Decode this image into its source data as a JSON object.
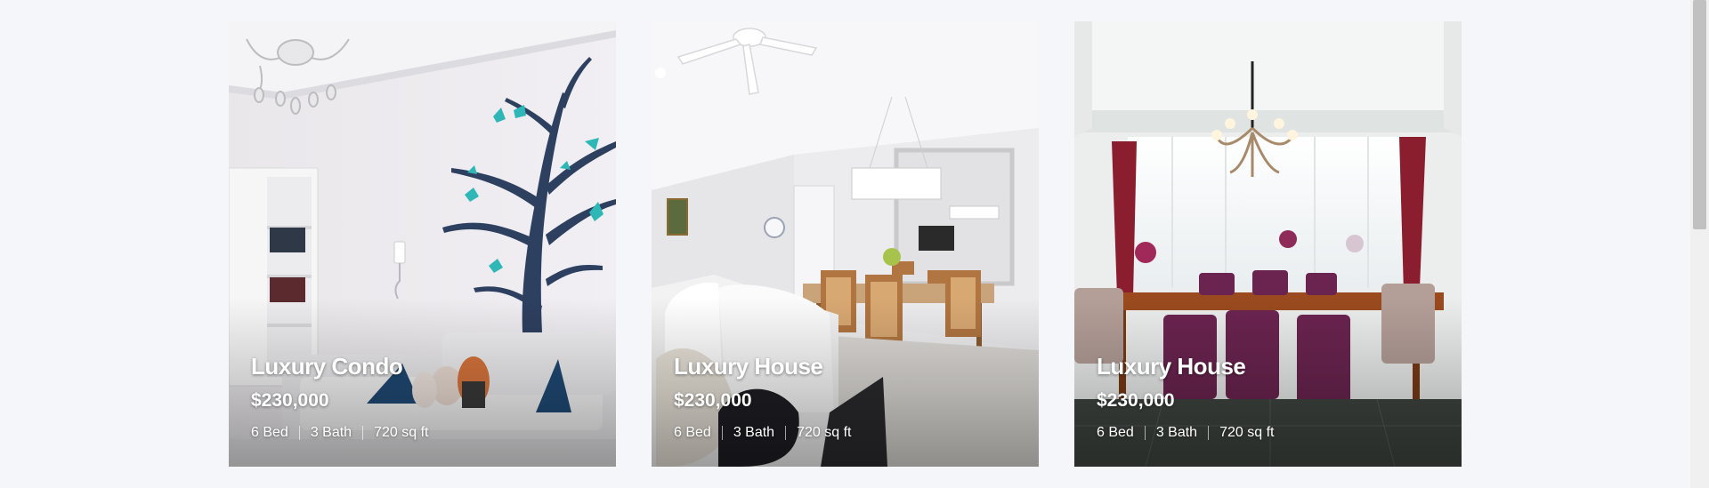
{
  "listings": [
    {
      "title": "Luxury Condo",
      "price": "$230,000",
      "beds": "6 Bed",
      "baths": "3 Bath",
      "area": "720 sq ft"
    },
    {
      "title": "Luxury House",
      "price": "$230,000",
      "beds": "6 Bed",
      "baths": "3 Bath",
      "area": "720 sq ft"
    },
    {
      "title": "Luxury House",
      "price": "$230,000",
      "beds": "6 Bed",
      "baths": "3 Bath",
      "area": "720 sq ft"
    }
  ]
}
